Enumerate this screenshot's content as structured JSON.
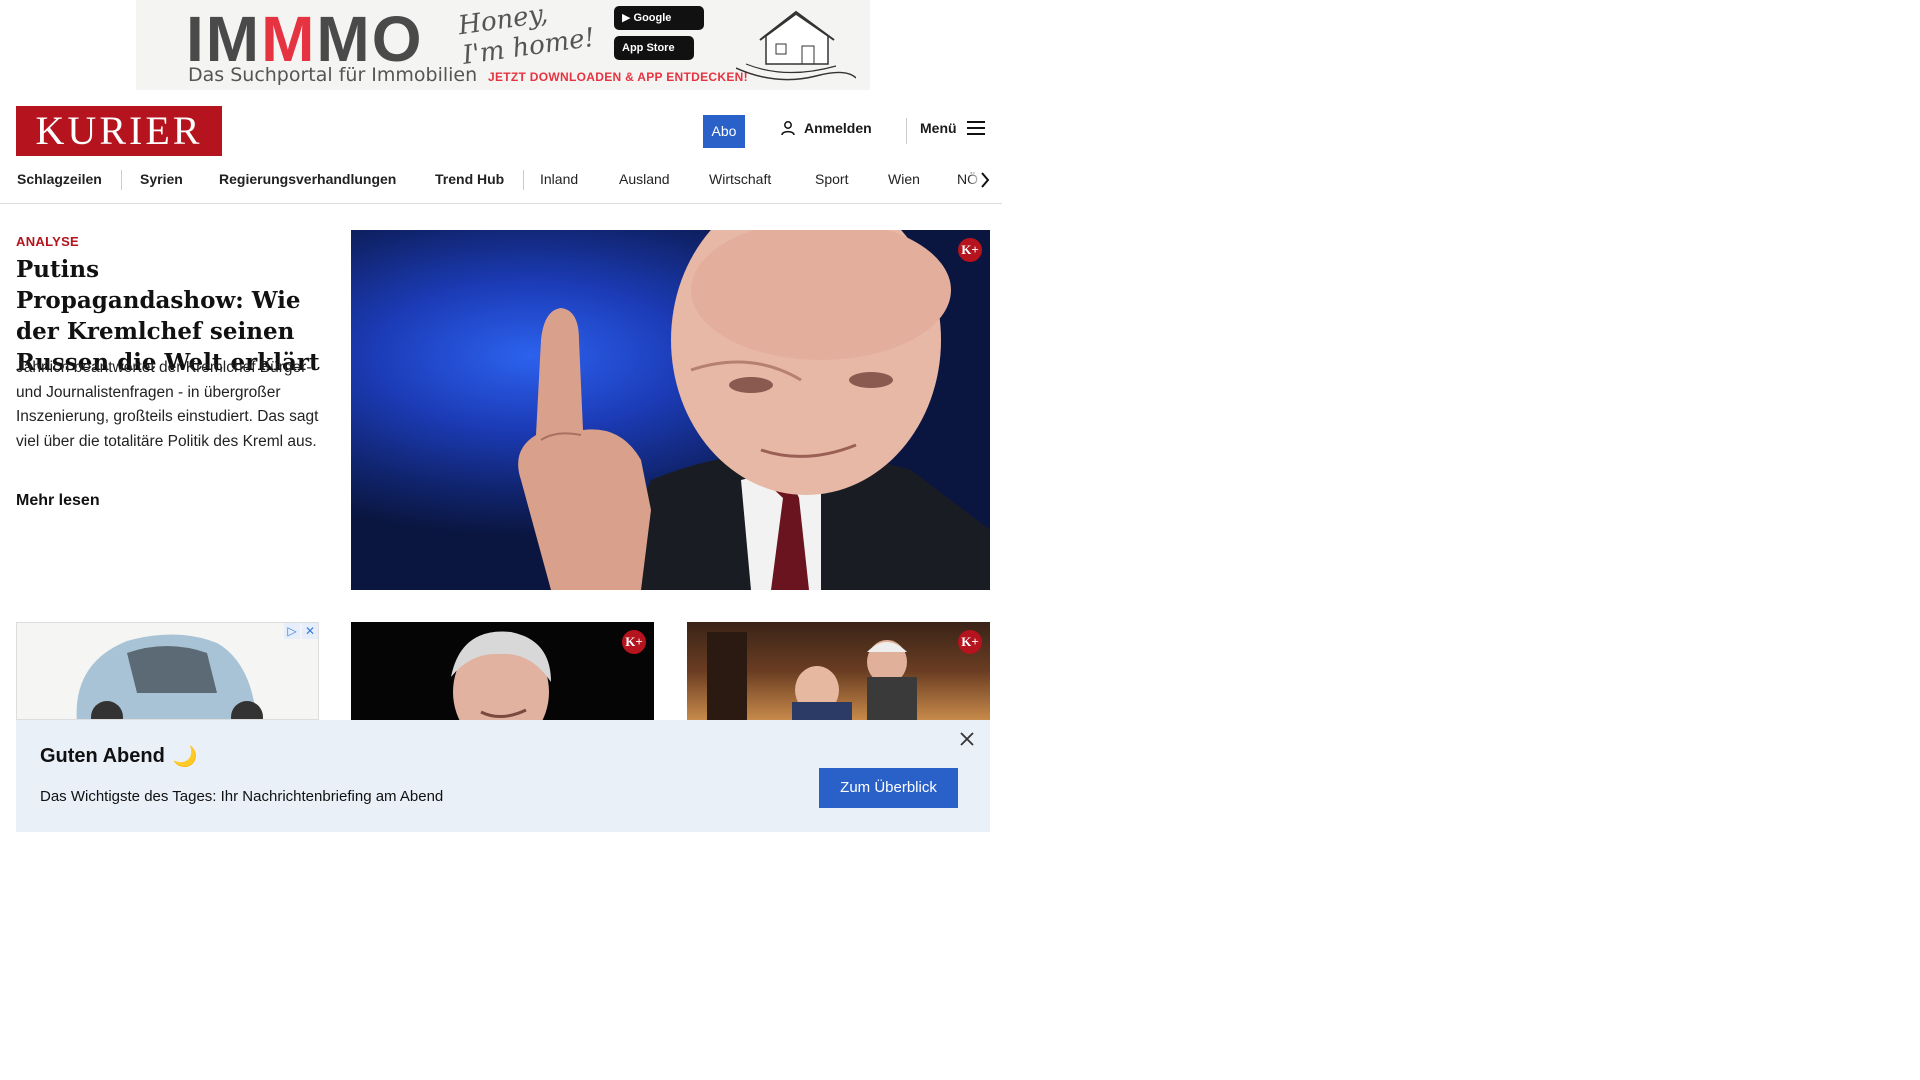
{
  "ad_banner": {
    "brand_start": "IM",
    "brand_mid": "M",
    "brand_end": "MO",
    "tagline": "Das Suchportal für Immobilien",
    "handwriting_line1": "Honey,",
    "handwriting_line2": "I'm home!",
    "google_play": "Google Play",
    "app_store": "App Store",
    "cta": "JETZT DOWNLOADEN & APP ENTDECKEN!"
  },
  "header": {
    "logo": "KURIER",
    "abo": "Abo",
    "login": "Anmelden",
    "menu": "Menü"
  },
  "nav": {
    "items": [
      "Schlagzeilen",
      "Syrien",
      "Regierungsverhandlungen",
      "Trend Hub",
      "Inland",
      "Ausland",
      "Wirtschaft",
      "Sport",
      "Wien",
      "NÖ"
    ]
  },
  "lead": {
    "kicker": "ANALYSE",
    "headline": "Putins Propagandashow: Wie der Kremlchef seinen Russen die Welt erklärt",
    "teaser": "Jährlich beantwortet der Kremlchef Bürger- und Journalistenfragen - in übergroßer Inszenierung, großteils einstudiert. Das sagt viel über die totalitäre Politik des Kreml aus.",
    "more": "Mehr lesen",
    "badge": "K+"
  },
  "cards": {
    "badge": "K+"
  },
  "briefing": {
    "title": "Guten Abend",
    "emoji": "🌙",
    "text": "Das Wichtigste des Tages: Ihr Nachrichtenbriefing am Abend",
    "button": "Zum Überblick"
  },
  "colors": {
    "brand_red": "#b5131e",
    "accent_blue": "#2a61c8",
    "briefing_bg": "#eaf0f8"
  }
}
